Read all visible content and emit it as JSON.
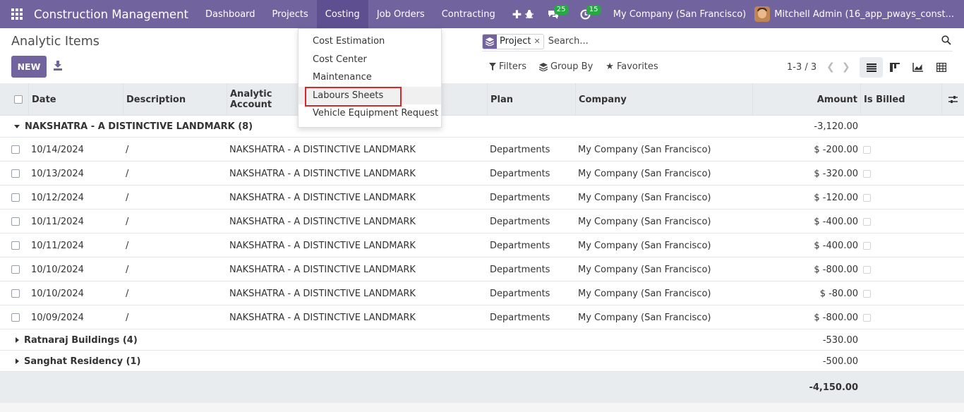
{
  "navbar": {
    "brand": "Construction Management",
    "menu": [
      "Dashboard",
      "Projects",
      "Costing",
      "Job Orders",
      "Contracting"
    ],
    "active_menu": "Costing",
    "messages_badge": "25",
    "activities_badge": "15",
    "company": "My Company (San Francisco)",
    "user": "Mitchell Admin (16_app_pways_const..."
  },
  "page": {
    "title": "Analytic Items",
    "new_label": "NEW"
  },
  "search": {
    "facet_label": "Project",
    "placeholder": "Search..."
  },
  "filters": {
    "filters_label": "Filters",
    "groupby_label": "Group By",
    "favorites_label": "Favorites"
  },
  "pager": {
    "value": "1-3 / 3"
  },
  "dropdown": {
    "items": [
      "Cost Estimation",
      "Cost Center",
      "Maintenance",
      "Labours Sheets",
      "Vehicle Equipment Request"
    ],
    "highlighted": "Labours Sheets"
  },
  "table": {
    "columns": {
      "date": "Date",
      "description": "Description",
      "account": "Analytic Account",
      "plan": "Plan",
      "company": "Company",
      "amount": "Amount",
      "billed": "Is Billed"
    },
    "groups": [
      {
        "label": "NAKSHATRA - A DISTINCTIVE LANDMARK (8)",
        "total": "-3,120.00",
        "expanded": true,
        "rows": [
          {
            "date": "10/14/2024",
            "description": "/",
            "account": "NAKSHATRA - A DISTINCTIVE LANDMARK",
            "plan": "Departments",
            "company": "My Company (San Francisco)",
            "amount": "$ -200.00"
          },
          {
            "date": "10/13/2024",
            "description": "/",
            "account": "NAKSHATRA - A DISTINCTIVE LANDMARK",
            "plan": "Departments",
            "company": "My Company (San Francisco)",
            "amount": "$ -320.00"
          },
          {
            "date": "10/12/2024",
            "description": "/",
            "account": "NAKSHATRA - A DISTINCTIVE LANDMARK",
            "plan": "Departments",
            "company": "My Company (San Francisco)",
            "amount": "$ -120.00"
          },
          {
            "date": "10/11/2024",
            "description": "/",
            "account": "NAKSHATRA - A DISTINCTIVE LANDMARK",
            "plan": "Departments",
            "company": "My Company (San Francisco)",
            "amount": "$ -400.00"
          },
          {
            "date": "10/11/2024",
            "description": "/",
            "account": "NAKSHATRA - A DISTINCTIVE LANDMARK",
            "plan": "Departments",
            "company": "My Company (San Francisco)",
            "amount": "$ -400.00"
          },
          {
            "date": "10/10/2024",
            "description": "/",
            "account": "NAKSHATRA - A DISTINCTIVE LANDMARK",
            "plan": "Departments",
            "company": "My Company (San Francisco)",
            "amount": "$ -800.00"
          },
          {
            "date": "10/10/2024",
            "description": "/",
            "account": "NAKSHATRA - A DISTINCTIVE LANDMARK",
            "plan": "Departments",
            "company": "My Company (San Francisco)",
            "amount": "$ -80.00"
          },
          {
            "date": "10/09/2024",
            "description": "/",
            "account": "NAKSHATRA - A DISTINCTIVE LANDMARK",
            "plan": "Departments",
            "company": "My Company (San Francisco)",
            "amount": "$ -800.00"
          }
        ]
      },
      {
        "label": "Ratnaraj Buildings (4)",
        "total": "-530.00",
        "expanded": false,
        "rows": []
      },
      {
        "label": "Sanghat Residency (1)",
        "total": "-500.00",
        "expanded": false,
        "rows": []
      }
    ],
    "grand_total": "-4,150.00"
  },
  "colors": {
    "brand": "#71639e",
    "highlight_border": "#d9262c",
    "badge": "#28a745"
  }
}
